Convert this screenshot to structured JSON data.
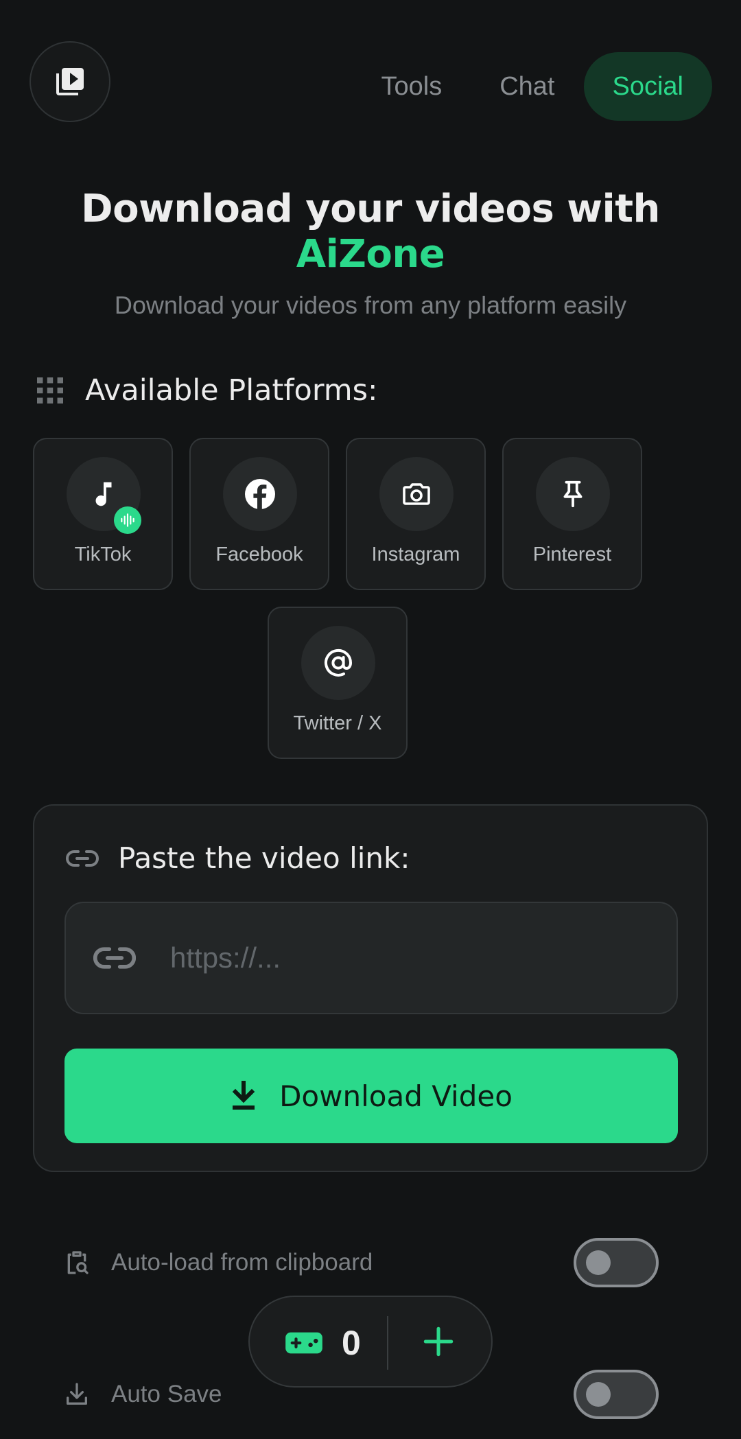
{
  "nav": {
    "items": [
      {
        "label": "Tools",
        "active": false
      },
      {
        "label": "Chat",
        "active": false
      },
      {
        "label": "Social",
        "active": true
      }
    ]
  },
  "hero": {
    "title": "Download your videos with",
    "brand": "AiZone",
    "subtitle": "Download your videos from any platform easily"
  },
  "platforms": {
    "heading": "Available Platforms:",
    "items": [
      {
        "label": "TikTok",
        "icon": "music-note-icon"
      },
      {
        "label": "Facebook",
        "icon": "facebook-icon"
      },
      {
        "label": "Instagram",
        "icon": "camera-icon"
      },
      {
        "label": "Pinterest",
        "icon": "pin-icon"
      },
      {
        "label": "Twitter / X",
        "icon": "at-sign-icon"
      }
    ]
  },
  "link": {
    "heading": "Paste the video link:",
    "placeholder": "https://...",
    "value": "",
    "button_label": "Download Video"
  },
  "settings": [
    {
      "label": "Auto-load from clipboard",
      "enabled": false
    },
    {
      "label": "Auto Save",
      "enabled": false
    }
  ],
  "fab": {
    "count": "0"
  },
  "colors": {
    "accent": "#2bd98b",
    "background": "#121415"
  }
}
